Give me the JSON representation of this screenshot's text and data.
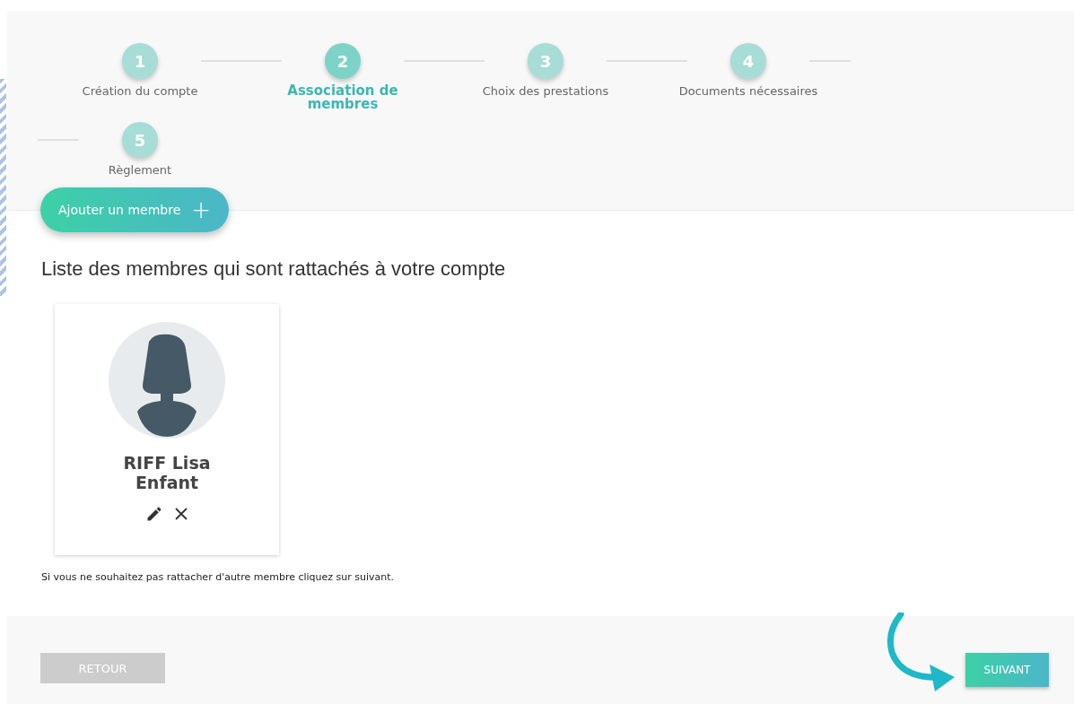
{
  "steps": [
    {
      "number": "1",
      "label": "Création du compte",
      "selected": false
    },
    {
      "number": "2",
      "label": "Association de membres",
      "selected": true
    },
    {
      "number": "3",
      "label": "Choix des prestations",
      "selected": false
    },
    {
      "number": "4",
      "label": "Documents nécessaires",
      "selected": false
    },
    {
      "number": "5",
      "label": "Règlement",
      "selected": false
    }
  ],
  "add_button": {
    "label": "Ajouter un membre",
    "icon": "+"
  },
  "heading": "Liste des membres qui sont rattachés à votre compte",
  "members": [
    {
      "name": "RIFF Lisa",
      "relation": "Enfant"
    }
  ],
  "note": "Si vous ne souhaitez pas rattacher d'autre membre cliquez sur suivant.",
  "footer": {
    "back": "RETOUR",
    "next": "SUIVANT"
  }
}
